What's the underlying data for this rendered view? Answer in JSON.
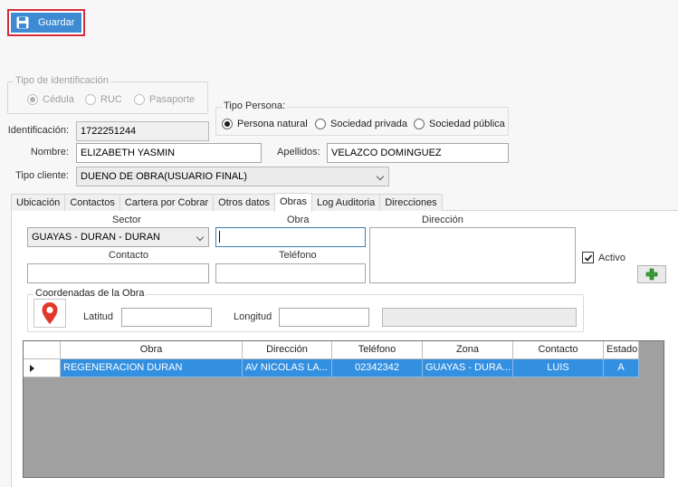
{
  "toolbar": {
    "save_label": "Guardar"
  },
  "id_type": {
    "title": "Tipo de identificación",
    "options": [
      "Cédula",
      "RUC",
      "Pasaporte"
    ],
    "selected": "Cédula"
  },
  "person_type": {
    "title": "Tipo Persona:",
    "options": [
      "Persona natural",
      "Sociedad privada",
      "Sociedad pública"
    ],
    "selected": "Persona natural"
  },
  "form": {
    "identificacion_label": "Identificación:",
    "identificacion_value": "1722251244",
    "nombre_label": "Nombre:",
    "nombre_value": "ELIZABETH YASMIN",
    "apellidos_label": "Apellidos:",
    "apellidos_value": "VELAZCO DOMINGUEZ",
    "tipo_cliente_label": "Tipo cliente:",
    "tipo_cliente_value": "DUENO DE OBRA(USUARIO FINAL)"
  },
  "tabs": [
    "Ubicación",
    "Contactos",
    "Cartera por Cobrar",
    "Otros datos",
    "Obras",
    "Log Auditoria",
    "Direcciones"
  ],
  "active_tab": "Obras",
  "obras": {
    "sector_label": "Sector",
    "sector_value": "GUAYAS - DURAN - DURAN",
    "obra_label": "Obra",
    "obra_value": "",
    "direccion_label": "Dirección",
    "direccion_value": "",
    "contacto_label": "Contacto",
    "contacto_value": "",
    "telefono_label": "Teléfono",
    "telefono_value": "",
    "activo_label": "Activo",
    "activo_checked": true,
    "coords_title": "Coordenadas de la Obra",
    "latitud_label": "Latitud",
    "latitud_value": "",
    "longitud_label": "Longitud",
    "longitud_value": ""
  },
  "grid": {
    "columns": [
      "Obra",
      "Dirección",
      "Teléfono",
      "Zona",
      "Contacto",
      "Estado"
    ],
    "rows": [
      [
        "REGENERACION DURAN",
        "AV NICOLAS LA...",
        "02342342",
        "GUAYAS - DURA...",
        "LUIS",
        "A"
      ]
    ]
  },
  "colors": {
    "accent_blue": "#3e8ad3",
    "selection_blue": "#3390e1",
    "highlight_red": "#d72c3c",
    "add_green": "#3aa13a",
    "pin_red": "#e2382a"
  }
}
